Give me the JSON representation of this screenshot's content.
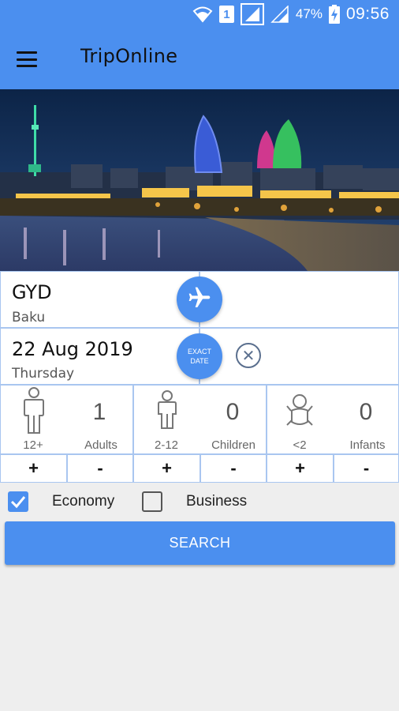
{
  "status_bar": {
    "battery": "47%",
    "time": "09:56",
    "sim_slot": "1"
  },
  "app_bar": {
    "title": "TripOnline"
  },
  "origin": {
    "code": "GYD",
    "city": "Baku"
  },
  "date": {
    "value": "22 Aug 2019",
    "weekday": "Thursday"
  },
  "date_mode_button": {
    "line1": "EXACT",
    "line2": "DATE"
  },
  "passengers": [
    {
      "age": "12+",
      "label": "Adults",
      "count": "1",
      "inc": "+",
      "dec": "-"
    },
    {
      "age": "2-12",
      "label": "Children",
      "count": "0",
      "inc": "+",
      "dec": "-"
    },
    {
      "age": "<2",
      "label": "Infants",
      "count": "0",
      "inc": "+",
      "dec": "-"
    }
  ],
  "cabin_class": [
    {
      "label": "Economy",
      "checked": true
    },
    {
      "label": "Business",
      "checked": false
    }
  ],
  "search_button": {
    "label": "SEARCH"
  },
  "colors": {
    "primary": "#4b8fef",
    "border": "#a9c6f0",
    "background": "#eeeeee"
  }
}
